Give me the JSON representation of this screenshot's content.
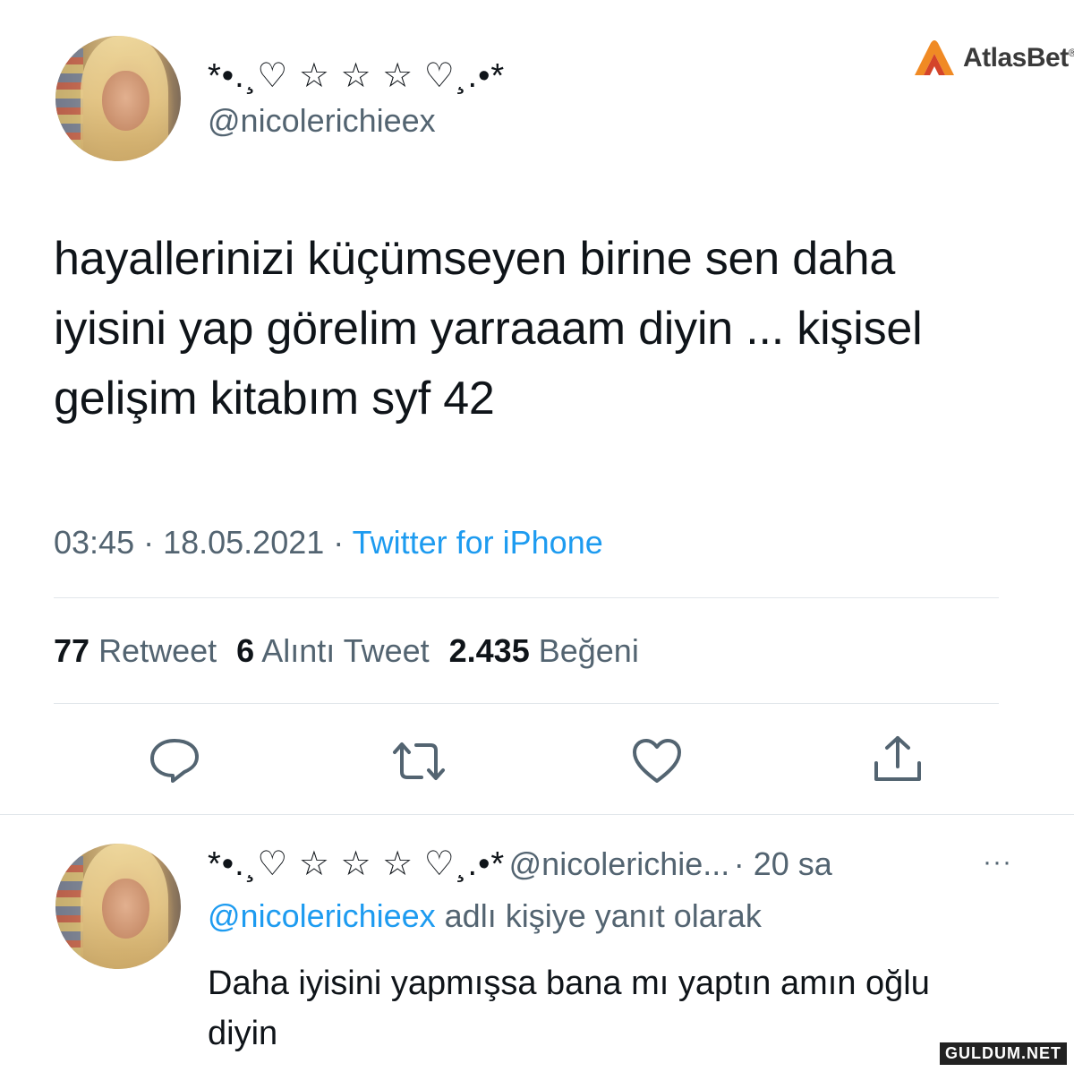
{
  "brand": {
    "name": "AtlasBet",
    "registered": "®",
    "logo_color": "#f08a24"
  },
  "tweet": {
    "display_name": "*•.¸♡ ☆ ☆ ☆ ♡¸.•*",
    "handle": "@nicolerichieex",
    "text": "hayallerinizi küçümseyen birine sen daha iyisini yap görelim yarraaam diyin ... kişisel gelişim kitabım syf 42",
    "time": "03:45",
    "separator": " · ",
    "date": "18.05.2021",
    "source": "Twitter for iPhone",
    "stats": {
      "retweets_count": "77",
      "retweets_label": "Retweet",
      "quotes_count": "6",
      "quotes_label": "Alıntı Tweet",
      "likes_count": "2.435",
      "likes_label": "Beğeni"
    },
    "actions": [
      "reply-icon",
      "retweet-icon",
      "like-icon",
      "share-icon"
    ]
  },
  "reply": {
    "display_name": "*•.¸♡ ☆ ☆ ☆ ♡¸.•*",
    "handle": "@nicolerichie...",
    "age": "· 20 sa",
    "more": "···",
    "replying_to_handle": "@nicolerichieex",
    "replying_to_suffix": " adlı kişiye yanıt olarak",
    "text": "Daha iyisini yapmışsa bana mı yaptın amın oğlu diyin"
  },
  "watermark": "GULDUM.NET",
  "colors": {
    "accent": "#1d9bf0",
    "text": "#0f1419",
    "muted": "#536471",
    "divider": "#e1e6ea"
  }
}
